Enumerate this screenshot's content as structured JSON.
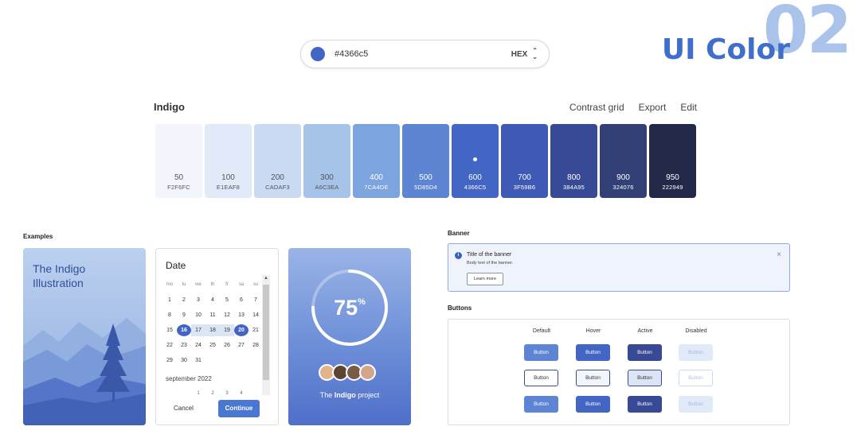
{
  "hero": {
    "number": "02",
    "title": "UI Color"
  },
  "picker": {
    "value": "#4366c5",
    "format": "HEX",
    "swatch_color": "#4366c5"
  },
  "palette": {
    "name": "Indigo",
    "actions": [
      "Contrast grid",
      "Export",
      "Edit"
    ],
    "shades": [
      {
        "shade": "50",
        "hex": "F2F6FC",
        "color": "#f2f6fc",
        "text": "#555"
      },
      {
        "shade": "100",
        "hex": "E1EAF8",
        "color": "#e1eaf8",
        "text": "#555"
      },
      {
        "shade": "200",
        "hex": "CADAF3",
        "color": "#cadaf3",
        "text": "#555"
      },
      {
        "shade": "300",
        "hex": "A6C3EA",
        "color": "#a6c3ea",
        "text": "#555"
      },
      {
        "shade": "400",
        "hex": "7CA4DE",
        "color": "#7ca4de",
        "text": "#ffffff"
      },
      {
        "shade": "500",
        "hex": "5D85D4",
        "color": "#5d85d4",
        "text": "#ffffff"
      },
      {
        "shade": "600",
        "hex": "4366C5",
        "color": "#4366c5",
        "text": "#ffffff",
        "selected": true
      },
      {
        "shade": "700",
        "hex": "3F59B6",
        "color": "#3f59b6",
        "text": "#ffffff"
      },
      {
        "shade": "800",
        "hex": "384A95",
        "color": "#384a95",
        "text": "#ffffff"
      },
      {
        "shade": "900",
        "hex": "324076",
        "color": "#324076",
        "text": "#ffffff"
      },
      {
        "shade": "950",
        "hex": "222949",
        "color": "#222949",
        "text": "#ffffff"
      }
    ]
  },
  "examples": {
    "label": "Examples",
    "illustration": {
      "title_line1": "The Indigo",
      "title_line2": "Illustration"
    },
    "date": {
      "title": "Date",
      "weekdays": [
        "mo",
        "tu",
        "we",
        "th",
        "fr",
        "sa",
        "su"
      ],
      "weeks": [
        [
          "",
          "",
          "",
          "",
          "",
          "",
          ""
        ],
        [
          "1",
          "2",
          "3",
          "4",
          "5",
          "6",
          "7"
        ],
        [
          "8",
          "9",
          "10",
          "11",
          "12",
          "13",
          "14"
        ],
        [
          "15",
          "16",
          "17",
          "18",
          "19",
          "20",
          "21"
        ],
        [
          "22",
          "23",
          "24",
          "25",
          "26",
          "27",
          "28"
        ],
        [
          "29",
          "30",
          "31",
          "",
          "",
          "",
          ""
        ]
      ],
      "next_month": "september 2022",
      "next_row": [
        "",
        "",
        "1",
        "2",
        "3",
        "4",
        ""
      ],
      "cancel": "Cancel",
      "continue": "Continue"
    },
    "progress": {
      "value": "75",
      "unit": "%",
      "fraction": 0.75,
      "project_prefix": "The ",
      "project_name": "Indigo",
      "project_suffix": " project"
    }
  },
  "banner": {
    "label": "Banner",
    "title": "Title of the banner",
    "body": "Body text of the banner.",
    "button": "Learn more",
    "close": "×"
  },
  "buttons": {
    "label": "Buttons",
    "columns": [
      "Default",
      "Hover",
      "Active",
      "Disabled"
    ],
    "button_label": "Button"
  }
}
